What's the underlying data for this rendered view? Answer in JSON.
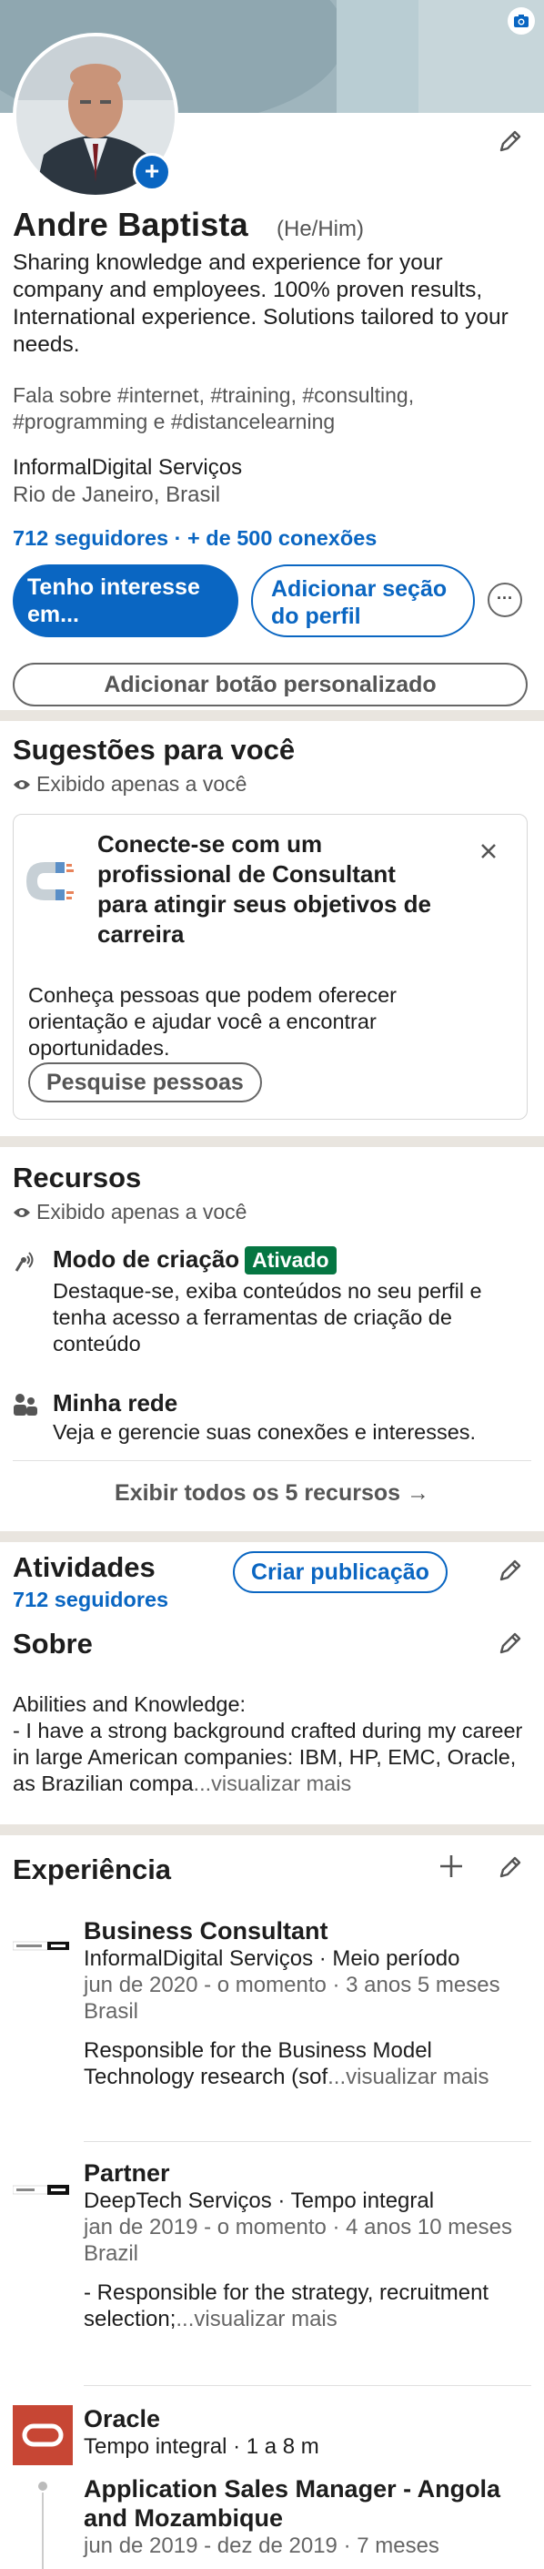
{
  "profile": {
    "name": "Andre Baptista",
    "pronouns": "(He/Him)",
    "headline": "Sharing knowledge and experience for your company and employees. 100% proven results, International experience. Solutions tailored to your needs.",
    "hashtags": "Fala sobre #internet, #training, #consulting, #programming e #distancelearning",
    "company": "InformalDigital Serviços",
    "location": "Rio de Janeiro, Brasil",
    "followers": "712 seguidores · + de 500 conexões",
    "btn_interest": "Tenho interesse em...",
    "btn_add_section": "Adicionar seção do perfil",
    "btn_more": "···",
    "btn_custom": "Adicionar botão personalizado"
  },
  "suggestions": {
    "title": "Sugestões para você",
    "visibility": "Exibido apenas a você",
    "card_title": "Conecte-se com um profissional de Consultant para atingir seus objetivos de carreira",
    "card_desc": "Conheça pessoas que podem oferecer orientação e ajudar você a encontrar oportunidades.",
    "card_btn": "Pesquise pessoas"
  },
  "resources": {
    "title": "Recursos",
    "visibility": "Exibido apenas a você",
    "items": [
      {
        "title": "Modo de criação",
        "badge": "Ativado",
        "desc": "Destaque-se, exiba conteúdos no seu perfil e tenha acesso a ferramentas de criação de conteúdo"
      },
      {
        "title": "Minha rede",
        "desc": "Veja e gerencie suas conexões e interesses."
      }
    ],
    "show_all": "Exibir todos os 5 recursos →"
  },
  "activity": {
    "title": "Atividades",
    "followers": "712 seguidores",
    "create_btn": "Criar publicação"
  },
  "about": {
    "title": "Sobre",
    "text": "Abilities and Knowledge:\n- I have a strong background crafted during my career in large American companies: IBM, HP, EMC, Oracle, as Brazilian compa",
    "more": "...visualizar mais"
  },
  "experience": {
    "title": "Experiência",
    "items": [
      {
        "title": "Business Consultant",
        "company": "InformalDigital Serviços · Meio período",
        "dates": "jun de 2020 - o momento · 3 anos 5 meses",
        "place": "Brasil",
        "desc": "Responsible for the Business Model Technology research (sof",
        "more": "...visualizar mais",
        "logo": "INFORMAL DIGITAL"
      },
      {
        "title": "Partner",
        "company": "DeepTech Serviços · Tempo integral",
        "dates": "jan de 2019 - o momento · 4 anos 10 meses",
        "place": "Brazil",
        "desc": "- Responsible for the strategy, recruitment selection;",
        "more": "...visualizar mais",
        "logo": "DEEP TECH"
      },
      {
        "title": "Oracle",
        "company": "Tempo integral · 1 a 8 m",
        "logo_color": "#c74634"
      }
    ],
    "sub_role": {
      "title": "Application Sales Manager - Angola and Mozambique",
      "dates": "jun de 2019 - dez de 2019 · 7 meses"
    }
  },
  "colors": {
    "accent": "#0a66c2",
    "badge": "#057642",
    "oracle": "#c74634"
  }
}
